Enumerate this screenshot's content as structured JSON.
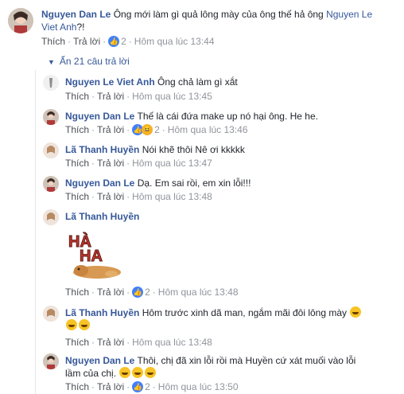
{
  "comment_main": {
    "author": "Nguyen Dan Le",
    "text": "Ông mới làm gì quả lông mày của ông thế hả ông",
    "mention_line1": "Nguyen Le",
    "mention_line2": "Viet Anh",
    "text_end": "?!",
    "like_label": "Thích",
    "reply_label": "Trả lời",
    "reaction_count": "2",
    "time": "Hôm qua lúc 13:44"
  },
  "hide_replies": "Ẩn 21 câu trả lời",
  "replies": [
    {
      "author": "Nguyen Le Viet Anh",
      "text": "Ông chả làm gì xắt",
      "like_label": "Thích",
      "reply_label": "Trả lời",
      "reaction_count": "",
      "time": "Hôm qua lúc 13:45"
    },
    {
      "author": "Nguyen Dan Le",
      "text": "Thế là cái đứa make up nó hại ông. He he.",
      "like_label": "Thích",
      "reply_label": "Trả lời",
      "reaction_count": "2",
      "time": "Hôm qua lúc 13:46"
    },
    {
      "author": "Lã Thanh Huyền",
      "text": "Nói khẽ thôi Nê ơi kkkkk",
      "like_label": "Thích",
      "reply_label": "Trả lời",
      "reaction_count": "",
      "time": "Hôm qua lúc 13:47"
    },
    {
      "author": "Nguyen Dan Le",
      "text": "Dạ. Em sai rồi, em xin lỗi!!!",
      "like_label": "Thích",
      "reply_label": "Trả lời",
      "reaction_count": "",
      "time": "Hôm qua lúc 13:48"
    },
    {
      "author": "Lã Thanh Huyền",
      "text": "",
      "sticker_text": "HA HA",
      "like_label": "Thích",
      "reply_label": "Trả lời",
      "reaction_count": "2",
      "time": "Hôm qua lúc 13:48"
    },
    {
      "author": "Lã Thanh Huyền",
      "text": "Hôm trước xinh dã man, ngắm mãi đôi lông mày",
      "like_label": "Thích",
      "reply_label": "Trả lời",
      "reaction_count": "",
      "time": "Hôm qua lúc 13:48"
    },
    {
      "author": "Nguyen Dan Le",
      "text": "Thôi, chị đã xin lỗi rồi mà Huyền cứ xát muối vào lỗi",
      "text_line2": "lầm của chị.",
      "like_label": "Thích",
      "reply_label": "Trả lời",
      "reaction_count": "2",
      "time": "Hôm qua lúc 13:50"
    }
  ],
  "icons": {
    "like": "thumbs-up-icon",
    "haha": "laughing-face-icon",
    "collapse": "triangle-down-icon"
  },
  "colors": {
    "link": "#365899",
    "meta": "#90949c",
    "like": "#4080ff",
    "haha": "#f7b125"
  }
}
